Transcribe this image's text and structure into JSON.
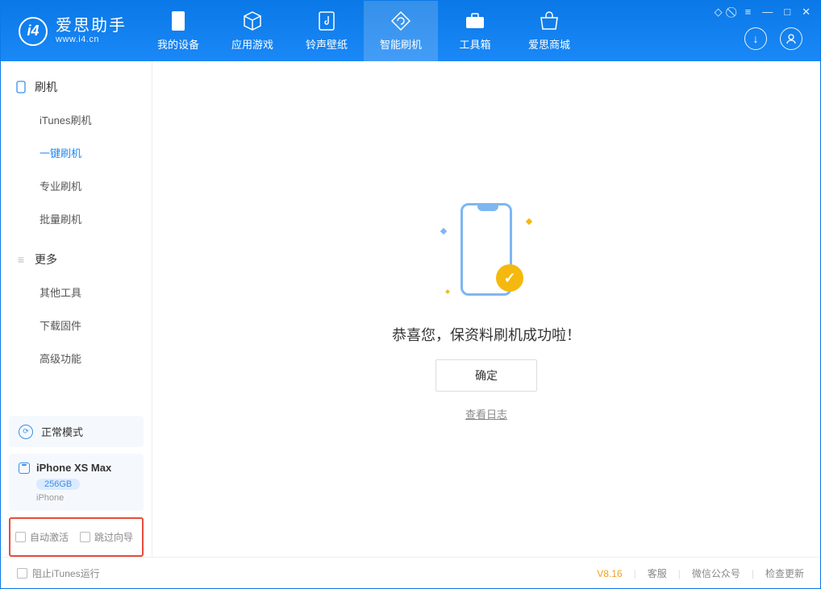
{
  "app": {
    "title": "爱思助手",
    "subtitle": "www.i4.cn"
  },
  "tabs": [
    {
      "label": "我的设备",
      "icon": "device"
    },
    {
      "label": "应用游戏",
      "icon": "cube"
    },
    {
      "label": "铃声壁纸",
      "icon": "music"
    },
    {
      "label": "智能刷机",
      "icon": "refresh",
      "active": true
    },
    {
      "label": "工具箱",
      "icon": "toolbox"
    },
    {
      "label": "爱思商城",
      "icon": "shop"
    }
  ],
  "sidebar": {
    "group1": {
      "title": "刷机"
    },
    "items1": [
      {
        "label": "iTunes刷机"
      },
      {
        "label": "一键刷机",
        "active": true
      },
      {
        "label": "专业刷机"
      },
      {
        "label": "批量刷机"
      }
    ],
    "group2": {
      "title": "更多"
    },
    "items2": [
      {
        "label": "其他工具"
      },
      {
        "label": "下载固件"
      },
      {
        "label": "高级功能"
      }
    ]
  },
  "mode": {
    "label": "正常模式"
  },
  "device": {
    "name": "iPhone XS Max",
    "capacity": "256GB",
    "type": "iPhone"
  },
  "options": {
    "auto_activate": "自动激活",
    "skip_guide": "跳过向导"
  },
  "main": {
    "success_msg": "恭喜您，保资料刷机成功啦！",
    "ok_label": "确定",
    "view_log": "查看日志"
  },
  "footer": {
    "block_itunes": "阻止iTunes运行",
    "version": "V8.16",
    "support": "客服",
    "wechat": "微信公众号",
    "check_update": "检查更新"
  }
}
